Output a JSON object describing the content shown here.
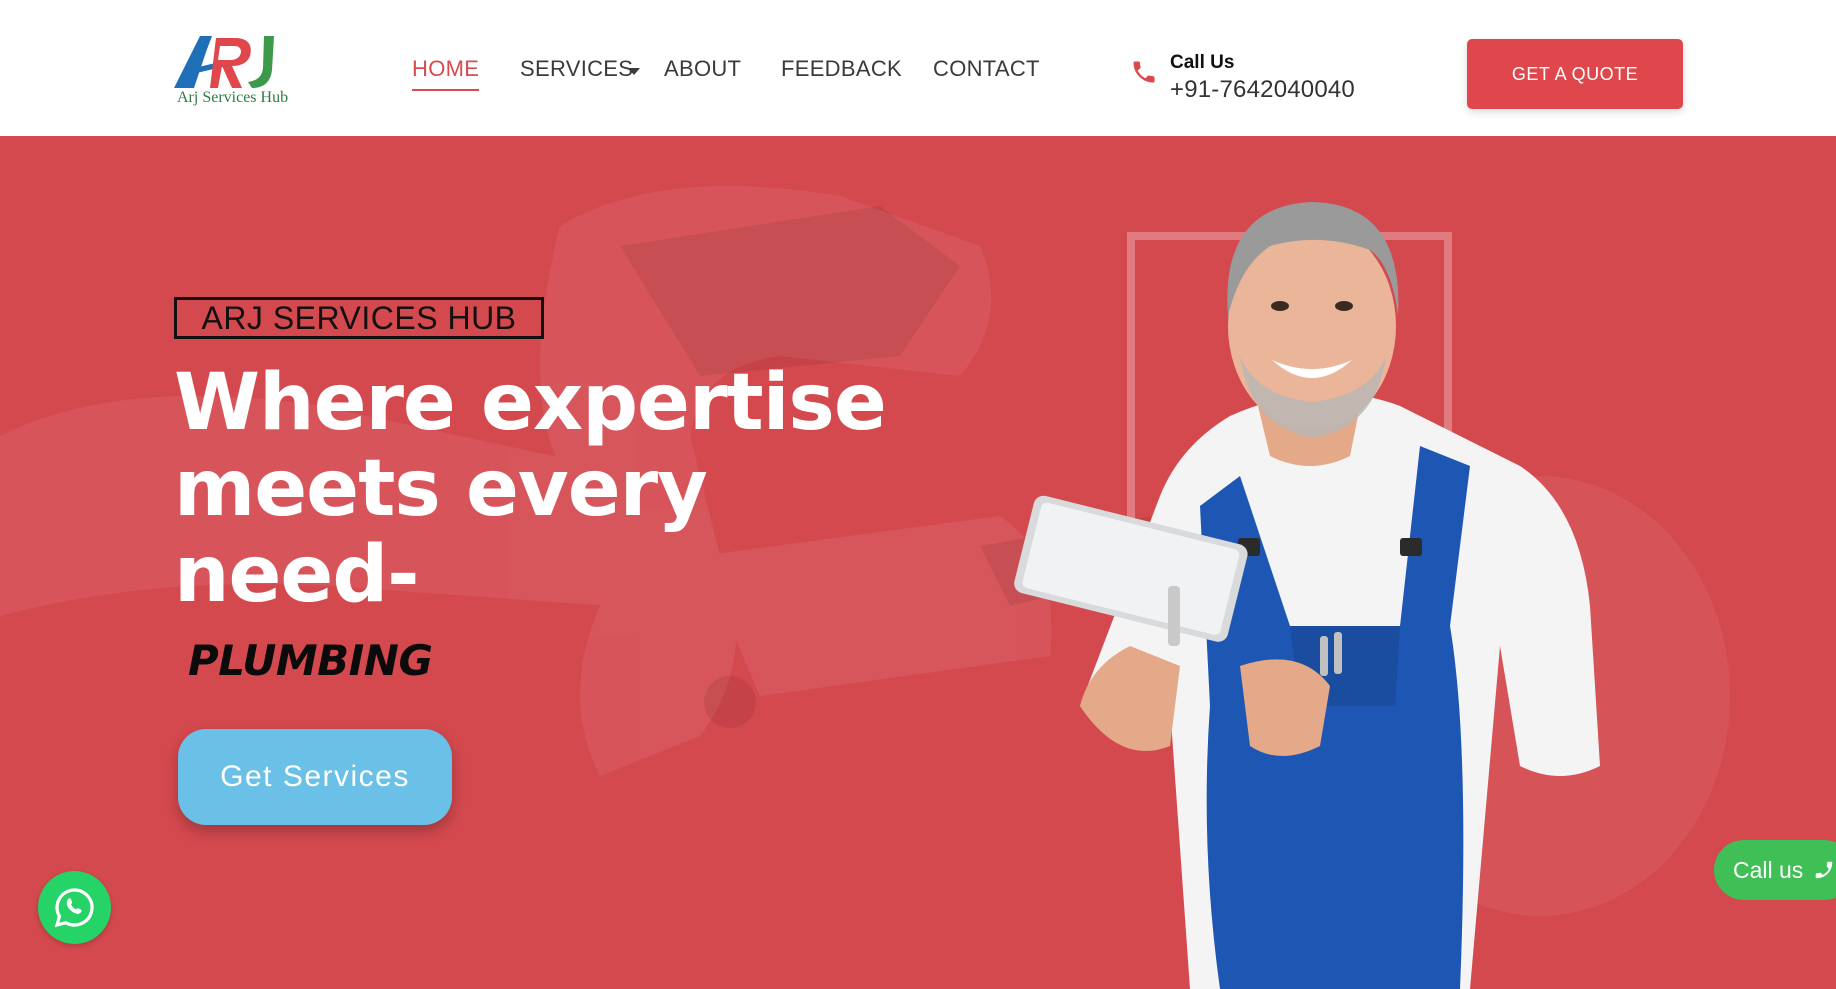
{
  "logo": {
    "letters": "ARJ",
    "subtitle": "Arj Services Hub"
  },
  "nav": {
    "items": [
      {
        "label": "HOME",
        "active": true
      },
      {
        "label": "SERVICES",
        "has_dropdown": true
      },
      {
        "label": "ABOUT"
      },
      {
        "label": "FEEDBACK"
      },
      {
        "label": "CONTACT"
      }
    ]
  },
  "contact": {
    "label": "Call Us",
    "number": "+91-7642040040",
    "icon": "phone-icon"
  },
  "quote_button": {
    "label": "GET A QUOTE"
  },
  "hero": {
    "brand": "ARJ SERVICES HUB",
    "headline_lines": [
      "Where expertise",
      "meets every",
      "need-"
    ],
    "service": "PLUMBING",
    "cta_label": "Get Services"
  },
  "floating": {
    "whatsapp_icon": "whatsapp-icon",
    "call_pill_label": "Call us",
    "call_pill_icon": "phone-icon"
  },
  "colors": {
    "accent": "#e0474c",
    "hero_bg": "#d4494e",
    "cta_blue": "#6ac0e6",
    "whatsapp_green": "#25d366",
    "call_pill_green": "#3fbf55"
  }
}
